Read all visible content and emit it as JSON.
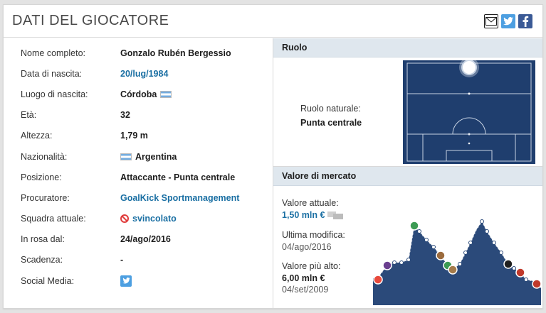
{
  "header": {
    "title": "DATI DEL GIOCATORE",
    "share_icons": [
      "mail-icon",
      "twitter-icon",
      "facebook-icon"
    ]
  },
  "info_rows": [
    {
      "label": "Nome completo:",
      "value": "Gonzalo Rubén Bergessio",
      "link": false
    },
    {
      "label": "Data di nascita:",
      "value": "20/lug/1984",
      "link": true
    },
    {
      "label": "Luogo di nascita:",
      "value": "Córdoba",
      "link": false,
      "flag": "argentina"
    },
    {
      "label": "Età:",
      "value": "32",
      "link": false
    },
    {
      "label": "Altezza:",
      "value": "1,79 m",
      "link": false
    },
    {
      "label": "Nazionalità:",
      "value": "Argentina",
      "link": false,
      "flag": "argentina"
    },
    {
      "label": "Posizione:",
      "value": "Attaccante - Punta centrale",
      "link": false
    },
    {
      "label": "Procuratore:",
      "value": "GoalKick Sportmanagement",
      "link": true
    },
    {
      "label": "Squadra attuale:",
      "value": "svincolato",
      "link": true,
      "icon": "no-club-icon"
    },
    {
      "label": "In rosa dal:",
      "value": "24/ago/2016",
      "link": false
    },
    {
      "label": "Scadenza:",
      "value": "-",
      "link": false
    },
    {
      "label": "Social Media:",
      "value": "",
      "link": false,
      "icon": "twitter-icon"
    }
  ],
  "ruolo": {
    "section_title": "Ruolo",
    "natural_label": "Ruolo naturale:",
    "natural_value": "Punta centrale"
  },
  "market": {
    "section_title": "Valore di mercato",
    "current_label": "Valore attuale:",
    "current_value": "1,50 mln €",
    "last_change_label": "Ultima modifica:",
    "last_change_date": "04/ago/2016",
    "highest_label": "Valore più alto:",
    "highest_value": "6,00 mln €",
    "highest_date": "04/set/2009"
  },
  "colors": {
    "link": "#1a6fa3",
    "pitch": "#1f3e6e",
    "graph_fill": "#2b4a7a",
    "section_bg": "#dfe7ee"
  }
}
